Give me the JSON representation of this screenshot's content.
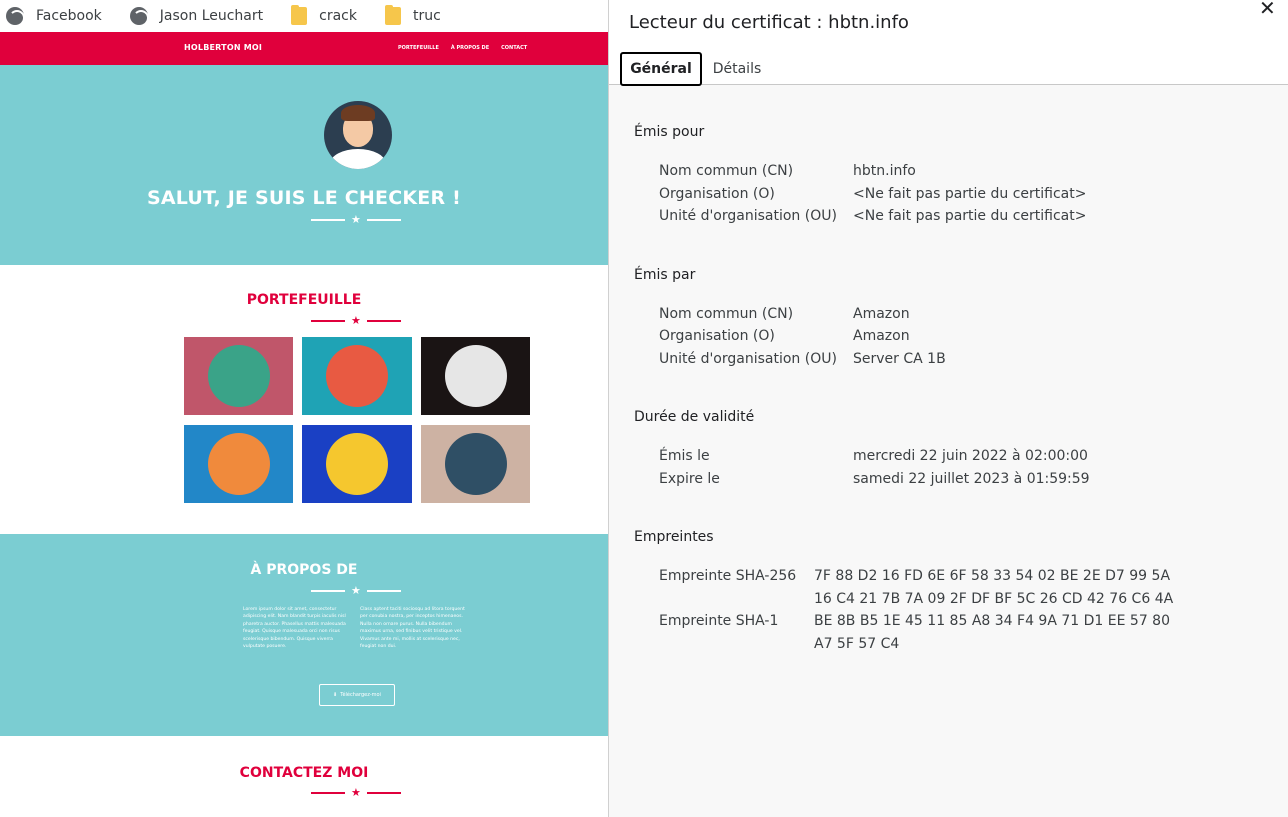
{
  "bookmarks": [
    {
      "label": "Facebook",
      "icon": "globe-icon"
    },
    {
      "label": "Jason Leuchart",
      "icon": "globe-icon"
    },
    {
      "label": "crack",
      "icon": "folder-icon"
    },
    {
      "label": "truc",
      "icon": "folder-icon"
    }
  ],
  "site": {
    "brand": "HOLBERTON MOI",
    "nav": [
      "PORTEFEUILLE",
      "À PROPOS DE",
      "CONTACT"
    ],
    "hero_title": "SALUT, JE SUIS LE CHECKER !",
    "portfolio_title": "PORTEFEUILLE",
    "tile_colors": [
      "#c0566a",
      "#1fa3b5",
      "#1a1414",
      "#2287c8",
      "#1a40c4",
      "#cdb2a3"
    ],
    "about_title": "À PROPOS DE",
    "about_col1": "Lorem ipsum dolor sit amet, consectetur adipiscing elit. Nam blandit turpis iaculis nisl pharetra auctor. Phasellus mattis malesuada feugiat. Quisque malesuada orci non risus scelerisque bibendum. Quisque viverra vulputate posuere.",
    "about_col2": "Class aptent taciti sociosqu ad litora torquent per conubia nostra, per inceptos himenaeos. Nulla non ornare purus. Nulla bibendum maximus urna, sed finibus velit tristique vel. Vivamus ante mi, mollis at scelerisque nec, feugiat non dui.",
    "download_label": "Téléchargez-moi",
    "contact_title": "CONTACTEZ MOI",
    "colors": {
      "red": "#e0003c",
      "teal": "#7bcdd2"
    }
  },
  "viewer": {
    "title": "Lecteur du certificat : hbtn.info",
    "tabs": {
      "general": "Général",
      "details": "Détails"
    },
    "issued_to": {
      "heading": "Émis pour",
      "cn_label": "Nom commun (CN)",
      "cn_value": "hbtn.info",
      "o_label": "Organisation (O)",
      "o_value": "<Ne fait pas partie du certificat>",
      "ou_label": "Unité d'organisation (OU)",
      "ou_value": "<Ne fait pas partie du certificat>"
    },
    "issued_by": {
      "heading": "Émis par",
      "cn_label": "Nom commun (CN)",
      "cn_value": "Amazon",
      "o_label": "Organisation (O)",
      "o_value": "Amazon",
      "ou_label": "Unité d'organisation (OU)",
      "ou_value": "Server CA 1B"
    },
    "validity": {
      "heading": "Durée de validité",
      "issued_label": "Émis le",
      "issued_value": "mercredi 22 juin 2022 à 02:00:00",
      "expires_label": "Expire le",
      "expires_value": "samedi 22 juillet 2023 à 01:59:59"
    },
    "fingerprints": {
      "heading": "Empreintes",
      "sha256_label": "Empreinte SHA-256",
      "sha256_line1": "7F 88 D2 16 FD 6E 6F 58 33 54 02 BE 2E D7 99 5A",
      "sha256_line2": "16 C4 21 7B 7A 09 2F DF BF 5C 26 CD 42 76 C6 4A",
      "sha1_label": "Empreinte SHA-1",
      "sha1_line1": "BE 8B B5 1E 45 11 85 A8 34 F4 9A 71 D1 EE 57 80",
      "sha1_line2": "A7 5F 57 C4"
    }
  }
}
